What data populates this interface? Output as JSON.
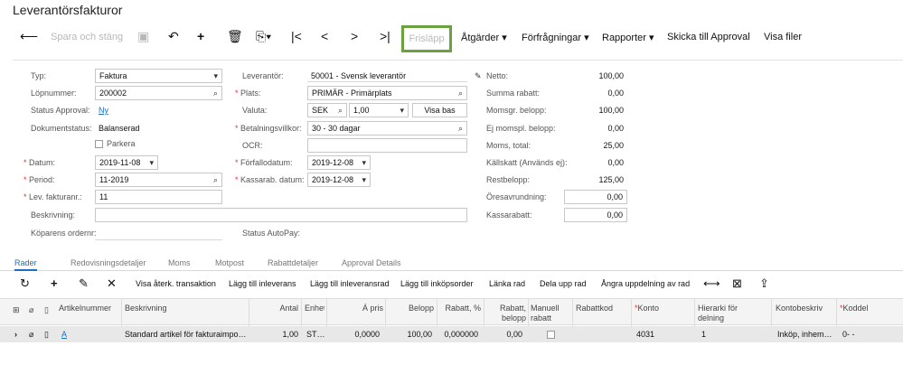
{
  "page_title": "Leverantörsfakturor",
  "toolbar": {
    "back_icon": "arrow-left-icon",
    "spara_och_stang": "Spara och stäng",
    "save_icon": "save-icon",
    "undo_icon": "undo-icon",
    "add_icon": "plus-icon",
    "delete_icon": "trash-icon",
    "copy_icon": "copy-paste-icon",
    "first_icon": "first-record-icon",
    "prev_icon": "previous-record-icon",
    "next_icon": "next-record-icon",
    "last_icon": "last-record-icon",
    "frislapp": "Frisläpp",
    "atgarder": "Åtgärder ▾",
    "forfragningar": "Förfrågningar ▾",
    "rapporter": "Rapporter ▾",
    "skicka": "Skicka till Approval",
    "visa_filer": "Visa filer",
    "highlight_color": "#6aa33e"
  },
  "form": {
    "typ_label": "Typ:",
    "typ_value": "Faktura",
    "lopnummer_label": "Löpnummer:",
    "lopnummer_value": "200002",
    "status_approval_label": "Status Approval:",
    "status_approval_value": "Ny",
    "dokumentstatus_label": "Dokumentstatus:",
    "dokumentstatus_value": "Balanserad",
    "parkera_label": "Parkera",
    "datum_label": "Datum:",
    "datum_value": "2019-11-08",
    "period_label": "Period:",
    "period_value": "11-2019",
    "lev_fakturanr_label": "Lev. fakturanr.:",
    "lev_fakturanr_value": "11",
    "beskrivning_label": "Beskrivning:",
    "kopares_ordernr_label": "Köparens ordernr:",
    "leverantor_label": "Leverantör:",
    "leverantor_value": "50001 - Svensk leverantör",
    "plats_label": "Plats:",
    "plats_value": "PRIMÄR - Primärplats",
    "valuta_label": "Valuta:",
    "valuta_value": "SEK",
    "valuta_rate": "1,00",
    "visa_bas": "Visa bas",
    "betalningsvillkor_label": "Betalningsvillkor:",
    "betalningsvillkor_value": "30 - 30 dagar",
    "ocr_label": "OCR:",
    "forfallodatum_label": "Förfallodatum:",
    "forfallodatum_value": "2019-12-08",
    "kassarab_datum_label": "Kassarab. datum:",
    "kassarab_datum_value": "2019-12-08",
    "status_autopay_label": "Status AutoPay:"
  },
  "summary": {
    "netto_label": "Netto:",
    "netto_value": "100,00",
    "summa_rabatt_label": "Summa rabatt:",
    "summa_rabatt_value": "0,00",
    "momsgr_label": "Momsgr. belopp:",
    "momsgr_value": "100,00",
    "ej_momspl_label": "Ej momspl. belopp:",
    "ej_momspl_value": "0,00",
    "moms_total_label": "Moms, total:",
    "moms_total_value": "25,00",
    "kallskatt_label": "Källskatt (Används ej):",
    "kallskatt_value": "0,00",
    "restbelopp_label": "Restbelopp:",
    "restbelopp_value": "125,00",
    "oresavrundning_label": "Öresavrundning:",
    "oresavrundning_value": "0,00",
    "kassarabatt_label": "Kassarabatt:",
    "kassarabatt_value": "0,00"
  },
  "tabs": [
    "Rader",
    "Redovisningsdetaljer",
    "Moms",
    "Motpost",
    "Rabattdetaljer",
    "Approval Details"
  ],
  "grid_toolbar": {
    "visa_aterk": "Visa återk. transaktion",
    "lagg_inleverans": "Lägg till inleverans",
    "lagg_inleveransrad": "Lägg till inleveransrad",
    "lagg_inkopsorder": "Lägg till inköpsorder",
    "lanka_rad": "Länka rad",
    "dela_upp_rad": "Dela upp rad",
    "angra_uppdelning": "Ångra uppdelning av rad"
  },
  "grid": {
    "headers": [
      "Artikelnummer",
      "Beskrivning",
      "Antal",
      "Enhet",
      "Á pris",
      "Belopp",
      "Rabatt, %",
      "Rabatt, belopp",
      "Manuell rabatt",
      "Rabattkod",
      "Konto",
      "Hierarki för delning",
      "Kontobeskriv",
      "Koddel"
    ],
    "row": {
      "artikel": "A",
      "beskrivning": "Standard artikel för fakturaimpo…",
      "antal": "1,00",
      "enhet": "ST…",
      "a_pris": "0,0000",
      "belopp": "100,00",
      "rabatt_pct": "0,000000",
      "rabatt_belopp": "0,00",
      "konto": "4031",
      "hierarki": "1",
      "kontobeskriv": "Inköp, inhem…",
      "koddel": "0- -"
    }
  }
}
